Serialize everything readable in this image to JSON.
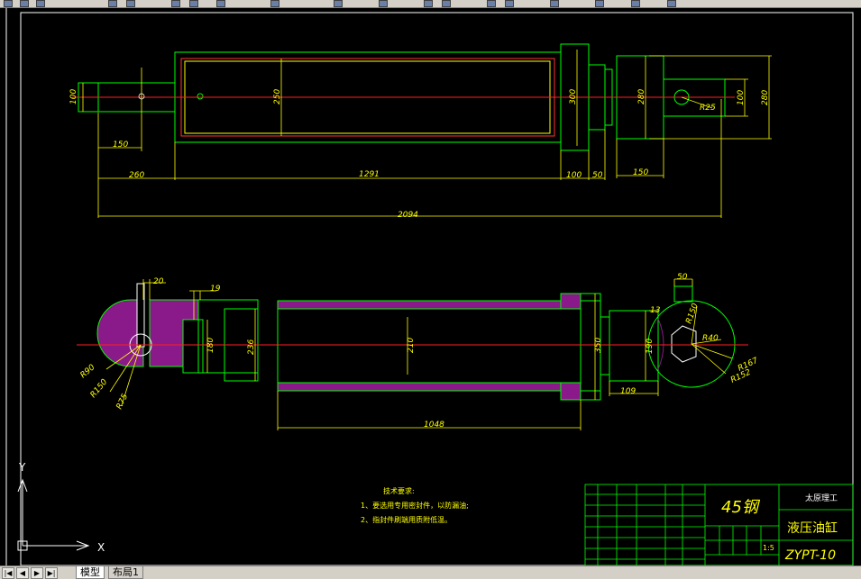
{
  "tabs": {
    "model": "模型",
    "layout1": "布局1"
  },
  "nav": {
    "first": "|◀",
    "prev": "◀",
    "next": "▶",
    "last": "▶|"
  },
  "dims_top": {
    "d100_left": "100",
    "d150_left": "150",
    "d260": "260",
    "d1291": "1291",
    "d250": "250",
    "d300": "300",
    "d280_a": "280",
    "d100_b": "100",
    "d50_a": "50",
    "d150_right": "150",
    "d280_right": "280",
    "d100_right": "100",
    "r25": "R25",
    "d2094": "2094"
  },
  "dims_bottom": {
    "d20": "20",
    "d19": "19",
    "d180": "180",
    "d236": "236",
    "d210": "210",
    "d350": "350",
    "d190": "190",
    "d13": "13",
    "d50": "50",
    "d109": "109",
    "d1048": "1048",
    "r90": "R90",
    "r150": "R150",
    "r75": "R75",
    "r150_right": "R150",
    "r40": "R40",
    "r167": "R167",
    "r152": "R152"
  },
  "notes": {
    "title": "技术要求:",
    "line1": "1、要选用专用密封件，以防漏油;",
    "line2": "2、指封件刷端用质附低温。"
  },
  "title_block": {
    "material": "45钢",
    "company": "太原理工",
    "name": "液压油缸",
    "drawing_no": "ZYPT-10",
    "scale": "1:5"
  },
  "ucs": {
    "x": "X",
    "y": "Y"
  }
}
